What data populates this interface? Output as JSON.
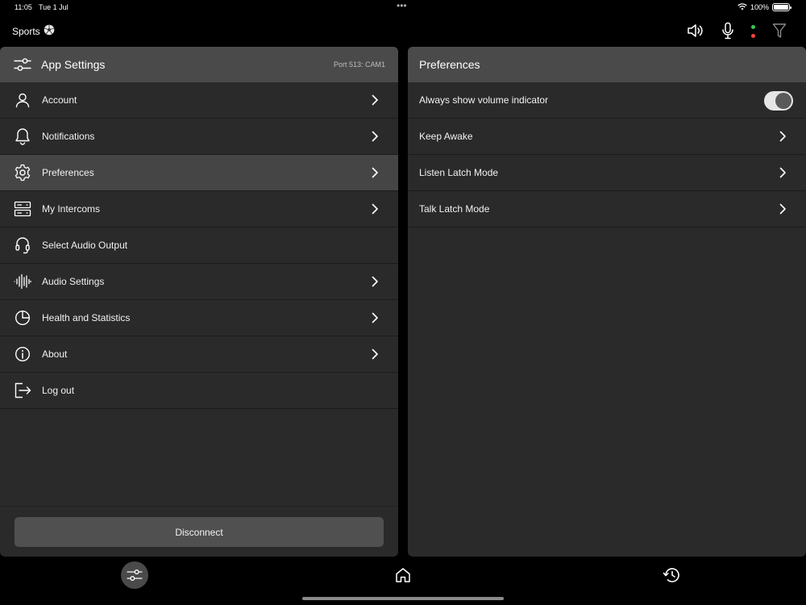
{
  "status_bar": {
    "time": "11:05",
    "date": "Tue 1 Jul",
    "battery": "100%",
    "dots": "•••"
  },
  "topbar": {
    "context_name": "Sports",
    "context_icon": "soccer-ball-icon",
    "icons": [
      "speaker-icon",
      "microphone-icon",
      "status-lights",
      "filter-icon"
    ],
    "status_colors": {
      "green": "#34c759",
      "red": "#ff453a"
    }
  },
  "left_panel": {
    "header": {
      "title": "App Settings",
      "subtitle": "Port 513: CAM1",
      "icon": "sliders-icon"
    },
    "items": [
      {
        "label": "Account",
        "icon": "person-icon",
        "chevron": true,
        "active": false
      },
      {
        "label": "Notifications",
        "icon": "bell-icon",
        "chevron": true,
        "active": false
      },
      {
        "label": "Preferences",
        "icon": "gear-icon",
        "chevron": true,
        "active": true
      },
      {
        "label": "My Intercoms",
        "icon": "server-icon",
        "chevron": true,
        "active": false
      },
      {
        "label": "Select Audio Output",
        "icon": "headset-icon",
        "chevron": false,
        "active": false
      },
      {
        "label": "Audio Settings",
        "icon": "waveform-icon",
        "chevron": true,
        "active": false
      },
      {
        "label": "Health and Statistics",
        "icon": "pie-chart-icon",
        "chevron": true,
        "active": false
      },
      {
        "label": "About",
        "icon": "info-icon",
        "chevron": true,
        "active": false
      },
      {
        "label": "Log out",
        "icon": "logout-icon",
        "chevron": false,
        "active": false
      }
    ],
    "disconnect_label": "Disconnect"
  },
  "right_panel": {
    "header": {
      "title": "Preferences"
    },
    "items": [
      {
        "label": "Always show volume indicator",
        "type": "toggle",
        "on": true
      },
      {
        "label": "Keep Awake",
        "type": "chevron"
      },
      {
        "label": "Listen Latch Mode",
        "type": "chevron"
      },
      {
        "label": "Talk Latch Mode",
        "type": "chevron"
      }
    ]
  },
  "bottom_nav": {
    "items": [
      {
        "icon": "sliders-icon",
        "active": true
      },
      {
        "icon": "home-icon",
        "active": false
      },
      {
        "icon": "history-icon",
        "active": false
      }
    ]
  },
  "colors": {
    "background": "#000000",
    "panel": "#2a2a2a",
    "panel_header": "#4a4a4a",
    "active_row": "#454545",
    "button": "#505050"
  }
}
